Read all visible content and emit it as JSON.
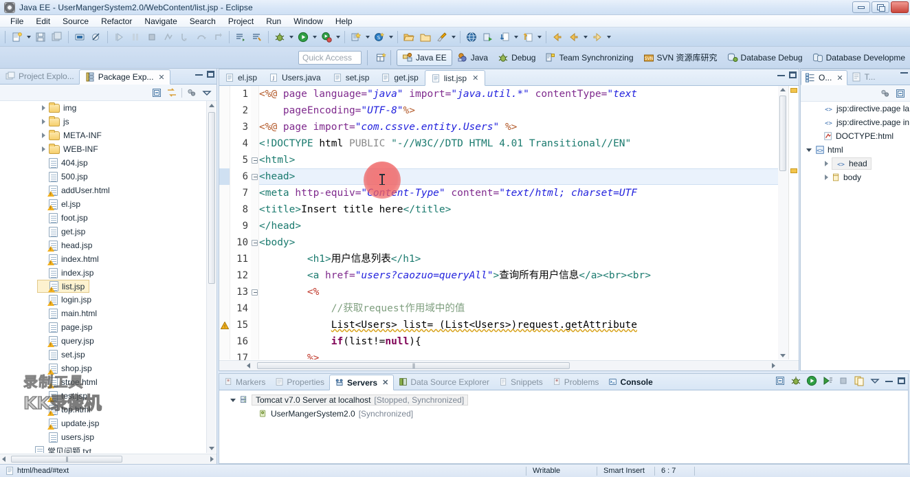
{
  "window": {
    "title": "Java EE - UserMangerSystem2.0/WebContent/list.jsp - Eclipse",
    "app_icon": "eclipse-icon",
    "minimize_label": "",
    "restore_label": "",
    "close_label": ""
  },
  "menu": {
    "items": [
      {
        "label": "File"
      },
      {
        "label": "Edit"
      },
      {
        "label": "Source"
      },
      {
        "label": "Refactor"
      },
      {
        "label": "Navigate"
      },
      {
        "label": "Search"
      },
      {
        "label": "Project"
      },
      {
        "label": "Run"
      },
      {
        "label": "Window"
      },
      {
        "label": "Help"
      }
    ]
  },
  "toolbar": {
    "groups": [
      {
        "icons": [
          "new-file-icon",
          "dropdown-arrow",
          "save-icon",
          "save-all-icon"
        ]
      },
      {
        "icons": [
          "print-icon",
          "toggle-markers-icon"
        ]
      },
      {
        "icons": [
          "resume-icon",
          "suspend-icon",
          "terminate-icon",
          "disconnect-icon",
          "step-into-icon",
          "step-over-icon",
          "step-return-icon"
        ]
      },
      {
        "icons": [
          "open-type-icon",
          "search-icon"
        ]
      },
      {
        "icons": [
          "debug-icon",
          "dropdown-arrow",
          "run-icon",
          "dropdown-arrow",
          "run-external-icon",
          "dropdown-arrow"
        ]
      },
      {
        "icons": [
          "new-web-project-icon",
          "dropdown-arrow",
          "new-server-icon",
          "dropdown-arrow"
        ]
      },
      {
        "icons": [
          "open-folder-icon",
          "close-folder-icon",
          "brush-icon",
          "dropdown-arrow"
        ]
      },
      {
        "icons": [
          "browser-icon",
          "validate-icon",
          "import-icon",
          "dropdown-arrow",
          "export-icon",
          "dropdown-arrow"
        ]
      },
      {
        "icons": [
          "back-icon",
          "back-history-icon",
          "dropdown-arrow",
          "forward-icon",
          "dropdown-arrow"
        ]
      }
    ]
  },
  "quick_access": {
    "placeholder": "Quick Access",
    "value": ""
  },
  "perspectives": {
    "open_perspective_icon": "open-perspective-icon",
    "items": [
      {
        "label": "Java EE",
        "icon": "java-ee-icon",
        "active": true
      },
      {
        "label": "Java",
        "icon": "java-icon",
        "active": false
      },
      {
        "label": "Debug",
        "icon": "debug-perspective-icon",
        "active": false
      },
      {
        "label": "Team Synchronizing",
        "icon": "team-sync-icon",
        "active": false
      },
      {
        "label": "SVN 资源库研究",
        "icon": "svn-icon",
        "active": false
      },
      {
        "label": "Database Debug",
        "icon": "database-debug-icon",
        "active": false
      },
      {
        "label": "Database Developme",
        "icon": "database-development-icon",
        "active": false
      }
    ]
  },
  "explorer": {
    "tabs": [
      {
        "label": "Project Explo...",
        "icon": "project-explorer-icon",
        "active": false,
        "closable": false
      },
      {
        "label": "Package Exp...",
        "icon": "package-explorer-icon",
        "active": true,
        "closable": true
      }
    ],
    "toolbar_icons": [
      "collapse-all-icon",
      "link-with-editor-icon",
      "view-menu-icon",
      "view-dropdown-icon"
    ],
    "tree": [
      {
        "label": "img",
        "type": "folder",
        "expandable": true,
        "indent": 1,
        "selected": false,
        "warn": false
      },
      {
        "label": "js",
        "type": "folder",
        "expandable": true,
        "indent": 1,
        "selected": false,
        "warn": false
      },
      {
        "label": "META-INF",
        "type": "folder",
        "expandable": true,
        "indent": 1,
        "selected": false,
        "warn": false
      },
      {
        "label": "WEB-INF",
        "type": "folder",
        "expandable": true,
        "indent": 1,
        "selected": false,
        "warn": false
      },
      {
        "label": "404.jsp",
        "type": "file",
        "expandable": false,
        "indent": 1,
        "selected": false,
        "warn": false
      },
      {
        "label": "500.jsp",
        "type": "file",
        "expandable": false,
        "indent": 1,
        "selected": false,
        "warn": false
      },
      {
        "label": "addUser.html",
        "type": "file",
        "expandable": false,
        "indent": 1,
        "selected": false,
        "warn": true
      },
      {
        "label": "el.jsp",
        "type": "file",
        "expandable": false,
        "indent": 1,
        "selected": false,
        "warn": true
      },
      {
        "label": "foot.jsp",
        "type": "file",
        "expandable": false,
        "indent": 1,
        "selected": false,
        "warn": false
      },
      {
        "label": "get.jsp",
        "type": "file",
        "expandable": false,
        "indent": 1,
        "selected": false,
        "warn": false
      },
      {
        "label": "head.jsp",
        "type": "file",
        "expandable": false,
        "indent": 1,
        "selected": false,
        "warn": true
      },
      {
        "label": "index.html",
        "type": "file",
        "expandable": false,
        "indent": 1,
        "selected": false,
        "warn": true
      },
      {
        "label": "index.jsp",
        "type": "file",
        "expandable": false,
        "indent": 1,
        "selected": false,
        "warn": false
      },
      {
        "label": "list.jsp",
        "type": "file",
        "expandable": false,
        "indent": 1,
        "selected": true,
        "warn": true
      },
      {
        "label": "login.jsp",
        "type": "file",
        "expandable": false,
        "indent": 1,
        "selected": false,
        "warn": true
      },
      {
        "label": "main.html",
        "type": "file",
        "expandable": false,
        "indent": 1,
        "selected": false,
        "warn": false
      },
      {
        "label": "page.jsp",
        "type": "file",
        "expandable": false,
        "indent": 1,
        "selected": false,
        "warn": false
      },
      {
        "label": "query.jsp",
        "type": "file",
        "expandable": false,
        "indent": 1,
        "selected": false,
        "warn": true
      },
      {
        "label": "set.jsp",
        "type": "file",
        "expandable": false,
        "indent": 1,
        "selected": false,
        "warn": false
      },
      {
        "label": "shop.jsp",
        "type": "file",
        "expandable": false,
        "indent": 1,
        "selected": false,
        "warn": true
      },
      {
        "label": "stroe.html",
        "type": "file",
        "expandable": false,
        "indent": 1,
        "selected": false,
        "warn": true
      },
      {
        "label": "test.jsp",
        "type": "file",
        "expandable": false,
        "indent": 1,
        "selected": false,
        "warn": true
      },
      {
        "label": "top.html",
        "type": "file",
        "expandable": false,
        "indent": 1,
        "selected": false,
        "warn": true
      },
      {
        "label": "update.jsp",
        "type": "file",
        "expandable": false,
        "indent": 1,
        "selected": false,
        "warn": true
      },
      {
        "label": "users.jsp",
        "type": "file",
        "expandable": false,
        "indent": 1,
        "selected": false,
        "warn": false
      },
      {
        "label": "常见问题.txt",
        "type": "file",
        "expandable": false,
        "indent": 0,
        "selected": false,
        "warn": false
      }
    ]
  },
  "editor": {
    "tabs": [
      {
        "label": "el.jsp",
        "icon": "jsp-file-icon",
        "active": false,
        "closable": false
      },
      {
        "label": "Users.java",
        "icon": "java-file-icon",
        "active": false,
        "closable": false
      },
      {
        "label": "set.jsp",
        "icon": "jsp-file-icon",
        "active": false,
        "closable": false
      },
      {
        "label": "get.jsp",
        "icon": "jsp-file-icon",
        "active": false,
        "closable": false
      },
      {
        "label": "list.jsp",
        "icon": "jsp-file-icon",
        "active": true,
        "closable": true
      }
    ],
    "current_line": 6,
    "lines": [
      {
        "n": 1,
        "fold": false,
        "warn": false,
        "segments": [
          {
            "t": "<%@ ",
            "c": "c-dir"
          },
          {
            "t": "page ",
            "c": "c-attr"
          },
          {
            "t": "language=",
            "c": "c-attr"
          },
          {
            "t": "\"java\"",
            "c": "c-str"
          },
          {
            "t": " import=",
            "c": "c-attr"
          },
          {
            "t": "\"java.util.*\"",
            "c": "c-str"
          },
          {
            "t": " contentType=",
            "c": "c-attr"
          },
          {
            "t": "\"text",
            "c": "c-str"
          }
        ]
      },
      {
        "n": 2,
        "fold": false,
        "warn": false,
        "segments": [
          {
            "t": "    ",
            "c": "c-plain"
          },
          {
            "t": "pageEncoding=",
            "c": "c-attr"
          },
          {
            "t": "\"UTF-8\"",
            "c": "c-str"
          },
          {
            "t": "%>",
            "c": "c-dir"
          }
        ]
      },
      {
        "n": 3,
        "fold": false,
        "warn": false,
        "segments": [
          {
            "t": "<%@ ",
            "c": "c-dir"
          },
          {
            "t": "page ",
            "c": "c-attr"
          },
          {
            "t": "import=",
            "c": "c-attr"
          },
          {
            "t": "\"com.cssve.entity.Users\"",
            "c": "c-str"
          },
          {
            "t": " ",
            "c": "c-plain"
          },
          {
            "t": "%>",
            "c": "c-dir"
          }
        ]
      },
      {
        "n": 4,
        "fold": false,
        "warn": false,
        "segments": [
          {
            "t": "<!DOCTYPE ",
            "c": "c-tag"
          },
          {
            "t": "html ",
            "c": "c-plain"
          },
          {
            "t": "PUBLIC ",
            "c": "c-gray"
          },
          {
            "t": "\"-//W3C//DTD HTML 4.01 Transitional//EN\"",
            "c": "c-tag"
          }
        ]
      },
      {
        "n": 5,
        "fold": true,
        "warn": false,
        "segments": [
          {
            "t": "<html>",
            "c": "c-tag"
          }
        ]
      },
      {
        "n": 6,
        "fold": true,
        "warn": false,
        "segments": [
          {
            "t": "<head>",
            "c": "c-tag"
          }
        ]
      },
      {
        "n": 7,
        "fold": false,
        "warn": false,
        "segments": [
          {
            "t": "<meta ",
            "c": "c-tag"
          },
          {
            "t": "http-equiv=",
            "c": "c-attr"
          },
          {
            "t": "\"Content-Type\"",
            "c": "c-str"
          },
          {
            "t": " content=",
            "c": "c-attr"
          },
          {
            "t": "\"text/html; charset=UTF",
            "c": "c-str"
          }
        ]
      },
      {
        "n": 8,
        "fold": false,
        "warn": false,
        "segments": [
          {
            "t": "<title>",
            "c": "c-tag"
          },
          {
            "t": "Insert title here",
            "c": "c-plain"
          },
          {
            "t": "</title>",
            "c": "c-tag"
          }
        ]
      },
      {
        "n": 9,
        "fold": false,
        "warn": false,
        "segments": [
          {
            "t": "</head>",
            "c": "c-tag"
          }
        ]
      },
      {
        "n": 10,
        "fold": true,
        "warn": false,
        "segments": [
          {
            "t": "<body>",
            "c": "c-tag"
          }
        ]
      },
      {
        "n": 11,
        "fold": false,
        "warn": false,
        "segments": [
          {
            "t": "        ",
            "c": "c-plain"
          },
          {
            "t": "<h1>",
            "c": "c-tag"
          },
          {
            "t": "用户信息列表",
            "c": "c-plain"
          },
          {
            "t": "</h1>",
            "c": "c-tag"
          }
        ]
      },
      {
        "n": 12,
        "fold": false,
        "warn": false,
        "segments": [
          {
            "t": "        ",
            "c": "c-plain"
          },
          {
            "t": "<a ",
            "c": "c-tag"
          },
          {
            "t": "href=",
            "c": "c-attr"
          },
          {
            "t": "\"users?caozuo=queryAll\"",
            "c": "c-str"
          },
          {
            "t": ">",
            "c": "c-tag"
          },
          {
            "t": "查询所有用户信息",
            "c": "c-plain"
          },
          {
            "t": "</a><br><br>",
            "c": "c-tag"
          }
        ]
      },
      {
        "n": 13,
        "fold": true,
        "warn": false,
        "segments": [
          {
            "t": "        ",
            "c": "c-plain"
          },
          {
            "t": "<%",
            "c": "c-red"
          }
        ]
      },
      {
        "n": 14,
        "fold": false,
        "warn": false,
        "segments": [
          {
            "t": "            ",
            "c": "c-plain"
          },
          {
            "t": "//获取request作用域中的值",
            "c": "c-cmt"
          }
        ]
      },
      {
        "n": 15,
        "fold": false,
        "warn": true,
        "segments": [
          {
            "t": "            ",
            "c": "c-plain"
          },
          {
            "t": "List<Users> list= (List<Users>)request.getAttribute",
            "c": "c-plain squiggle"
          }
        ]
      },
      {
        "n": 16,
        "fold": false,
        "warn": false,
        "segments": [
          {
            "t": "            ",
            "c": "c-plain"
          },
          {
            "t": "if",
            "c": "c-kw"
          },
          {
            "t": "(list!=",
            "c": "c-plain"
          },
          {
            "t": "null",
            "c": "c-kw"
          },
          {
            "t": "){",
            "c": "c-plain"
          }
        ]
      },
      {
        "n": 17,
        "fold": false,
        "warn": false,
        "segments": [
          {
            "t": "        ",
            "c": "c-plain"
          },
          {
            "t": "%>",
            "c": "c-red"
          }
        ]
      }
    ]
  },
  "bottom_view": {
    "tabs": [
      {
        "label": "Markers",
        "icon": "markers-icon",
        "active": false,
        "bold": false
      },
      {
        "label": "Properties",
        "icon": "properties-icon",
        "active": false,
        "bold": false
      },
      {
        "label": "Servers",
        "icon": "servers-icon",
        "active": true,
        "bold": true
      },
      {
        "label": "Data Source Explorer",
        "icon": "data-source-explorer-icon",
        "active": false,
        "bold": false
      },
      {
        "label": "Snippets",
        "icon": "snippets-icon",
        "active": false,
        "bold": false
      },
      {
        "label": "Problems",
        "icon": "problems-icon",
        "active": false,
        "bold": false
      },
      {
        "label": "Console",
        "icon": "console-icon",
        "active": false,
        "bold": true
      }
    ],
    "toolbar_icons": [
      "collapse-all-icon",
      "debug-server-icon",
      "start-server-icon",
      "profile-server-icon",
      "stop-server-icon",
      "publish-icon",
      "view-menu-icon",
      "minimize-icon",
      "maximize-icon"
    ],
    "rows": [
      {
        "label": "Tomcat v7.0 Server at localhost",
        "status": "[Stopped, Synchronized]",
        "indent": 0,
        "expanded": true,
        "icon": "server-icon",
        "selected": true
      },
      {
        "label": "UserMangerSystem2.0",
        "status": "[Synchronized]",
        "indent": 1,
        "expanded": false,
        "icon": "module-icon",
        "selected": false
      }
    ]
  },
  "outline": {
    "tabs": [
      {
        "label": "O...",
        "icon": "outline-icon",
        "active": true,
        "closable": true
      },
      {
        "label": "T...",
        "icon": "task-list-icon",
        "active": false,
        "closable": false
      }
    ],
    "toolbar_icons": [
      "sort-icon",
      "collapse-all-icon"
    ],
    "rows": [
      {
        "label": "jsp:directive.page la",
        "icon": "angle-icon",
        "indent": 1,
        "expandable": false,
        "expanded": false,
        "selected": false
      },
      {
        "label": "jsp:directive.page in",
        "icon": "angle-icon",
        "indent": 1,
        "expandable": false,
        "expanded": false,
        "selected": false
      },
      {
        "label": "DOCTYPE:html",
        "icon": "doctype-icon",
        "indent": 1,
        "expandable": false,
        "expanded": false,
        "selected": false
      },
      {
        "label": "html",
        "icon": "element-icon",
        "indent": 0,
        "expandable": true,
        "expanded": true,
        "selected": false
      },
      {
        "label": "head",
        "icon": "angle-icon",
        "indent": 2,
        "expandable": true,
        "expanded": false,
        "selected": true
      },
      {
        "label": "body",
        "icon": "body-icon",
        "indent": 2,
        "expandable": true,
        "expanded": false,
        "selected": false
      }
    ]
  },
  "statusbar": {
    "path": "html/head/#text",
    "path_icon": "file-icon",
    "writable": "Writable",
    "insert_mode": "Smart Insert",
    "position": "6 : 7"
  },
  "watermark": {
    "line1": "录制工具",
    "line2": "KK录像机"
  },
  "colors": {
    "accent": "#2222dd",
    "tag": "#1a7a6e",
    "directive": "#b35a2a",
    "attribute": "#7f2a8d",
    "comment": "#7f9f7f",
    "selection": "#fdf2d0",
    "chrome": "#cddff2"
  }
}
